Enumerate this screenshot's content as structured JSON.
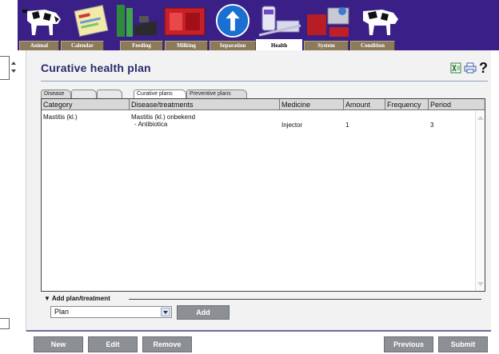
{
  "app": {
    "nav_tabs": [
      "Animal",
      "Calendar",
      "Feeding",
      "Milking",
      "Separation",
      "Health",
      "System",
      "Condition"
    ],
    "active_tab": "Health"
  },
  "page": {
    "title": "Curative health plan",
    "help_glyph": "?"
  },
  "sub_tabs": {
    "disease": "Disease",
    "curative_plans": "Curative plans",
    "preventive_plans": "Preventive plans"
  },
  "table": {
    "columns": [
      "Category",
      "Disease/treatments",
      "Medicine",
      "Amount",
      "Frequency",
      "Period"
    ],
    "rows": [
      {
        "category": "Mastitis (kl.)",
        "disease": "Mastitis (kl.) onbekend",
        "treatment": "- Antibiotica",
        "medicine": "Injector",
        "amount": "1",
        "frequency": "",
        "period": "3"
      }
    ]
  },
  "add_section": {
    "header": "▼ Add plan/treatment",
    "select_value": "Plan",
    "add_label": "Add"
  },
  "footer": {
    "new_label": "New",
    "edit_label": "Edit",
    "remove_label": "Remove",
    "previous_label": "Previous",
    "submit_label": "Submit"
  },
  "colors": {
    "banner": "#3a1f86",
    "tab": "#8c7a5a",
    "button": "#8c9095",
    "title": "#2a2a70"
  }
}
